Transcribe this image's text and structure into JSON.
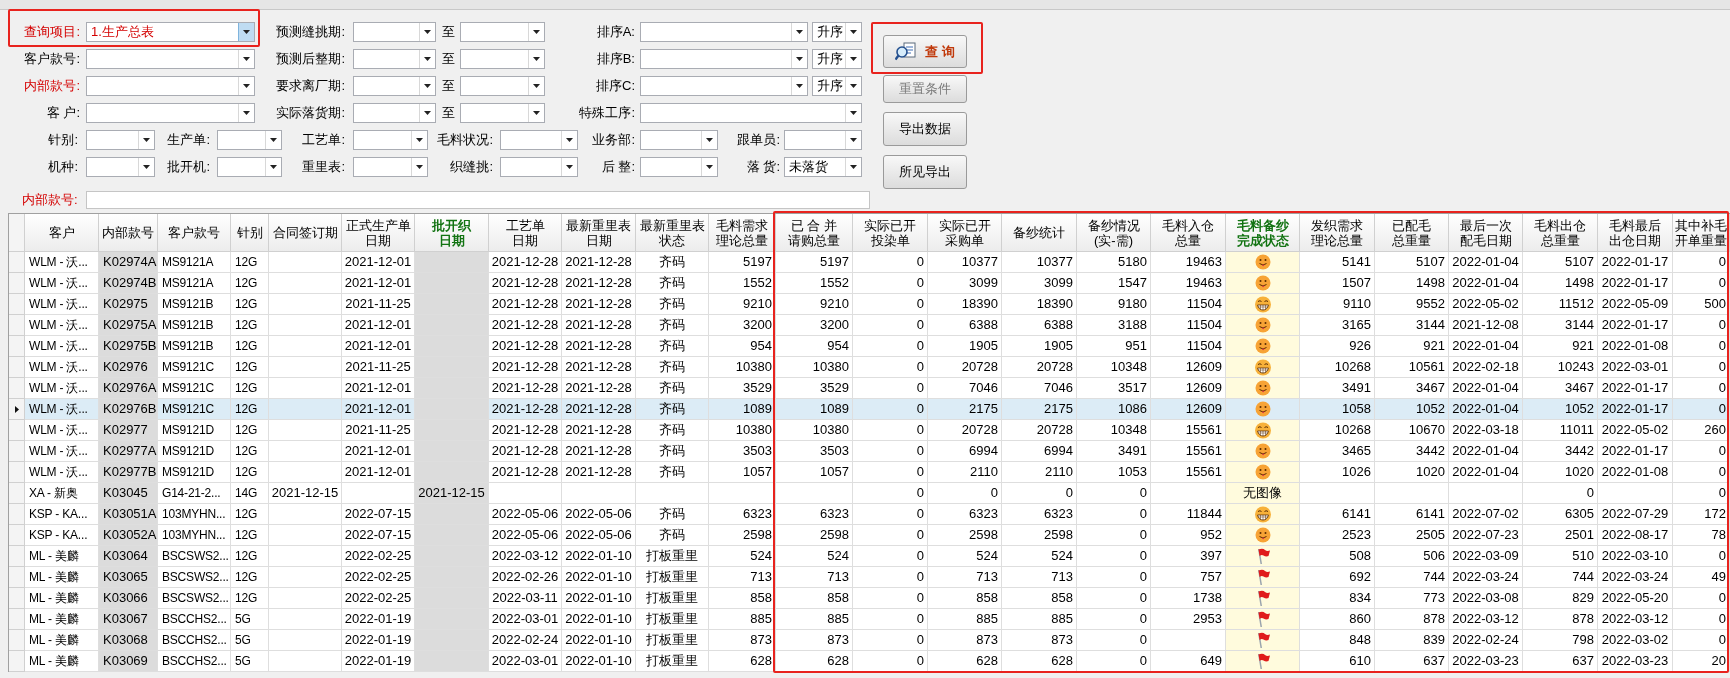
{
  "filters": {
    "rows": [
      {
        "left": {
          "label": "查询项目:",
          "value": "1.生产总表",
          "emphasis": true,
          "focused": true
        },
        "range": {
          "label": "预测缝挑期:",
          "to": "至"
        },
        "right": {
          "label": "排序A:",
          "order": "升序"
        }
      },
      {
        "left": {
          "label": "客户款号:",
          "emphasis": false
        },
        "range": {
          "label": "预测后整期:",
          "to": "至"
        },
        "right": {
          "label": "排序B:",
          "order": "升序"
        }
      },
      {
        "left": {
          "label": "内部款号:",
          "emphasis": true
        },
        "range": {
          "label": "要求离厂期:",
          "to": "至"
        },
        "right": {
          "label": "排序C:",
          "order": "升序"
        }
      },
      {
        "left": {
          "label": "客 户:",
          "emphasis": false
        },
        "range": {
          "label": "实际落货期:",
          "to": "至"
        },
        "right": {
          "label": "特殊工序:"
        }
      }
    ],
    "small_rows": [
      [
        {
          "label": "针别:"
        },
        {
          "label": "生产单:"
        },
        {
          "label": "工艺单:"
        },
        {
          "label": "毛料状况:"
        },
        {
          "label": "业务部:"
        },
        {
          "label": "跟单员:"
        }
      ],
      [
        {
          "label": "机种:"
        },
        {
          "label": "批开机:"
        },
        {
          "label": "重里表:"
        },
        {
          "label": "织缝挑:"
        },
        {
          "label": "后 整:"
        },
        {
          "label": "落 货:",
          "value": "未落货"
        }
      ]
    ],
    "bottom": {
      "label": "内部款号:",
      "emphasis": true
    }
  },
  "buttons": [
    {
      "kind": "search",
      "label": "查 询",
      "disabled": false
    },
    {
      "kind": "plain",
      "label": "重置条件",
      "disabled": true
    },
    {
      "kind": "plain",
      "label": "导出数据",
      "disabled": false
    },
    {
      "kind": "plain",
      "label": "所见导出",
      "disabled": false
    }
  ],
  "table": {
    "columns": [
      {
        "lines": [
          "客户"
        ],
        "kind": "text"
      },
      {
        "lines": [
          "内部款号"
        ],
        "kind": "shaded"
      },
      {
        "lines": [
          "客户款号"
        ],
        "kind": "text"
      },
      {
        "lines": [
          "针别"
        ],
        "kind": "text"
      },
      {
        "lines": [
          "合同签订期"
        ],
        "kind": "date"
      },
      {
        "lines": [
          "正式生产单",
          "日期"
        ],
        "kind": "date"
      },
      {
        "lines": [
          "批开织",
          "日期"
        ],
        "kind": "shaded-date",
        "highlight": true
      },
      {
        "lines": [
          "工艺单",
          "日期"
        ],
        "kind": "date"
      },
      {
        "lines": [
          "最新重里表",
          "日期"
        ],
        "kind": "date"
      },
      {
        "lines": [
          "最新重里表",
          "状态"
        ],
        "kind": "date"
      },
      {
        "lines": [
          "毛料需求",
          "理论总量"
        ],
        "kind": "number"
      },
      {
        "lines": [
          "已 合 并",
          "请购总量"
        ],
        "kind": "number"
      },
      {
        "lines": [
          "实际已开",
          "投染单"
        ],
        "kind": "number"
      },
      {
        "lines": [
          "实际已开",
          "采购单"
        ],
        "kind": "number"
      },
      {
        "lines": [
          "备纱统计"
        ],
        "kind": "number"
      },
      {
        "lines": [
          "备纱情况",
          "(实-需)"
        ],
        "kind": "number"
      },
      {
        "lines": [
          "毛料入仓",
          "总量"
        ],
        "kind": "number"
      },
      {
        "lines": [
          "毛料备纱",
          "完成状态"
        ],
        "kind": "status",
        "highlight": true
      },
      {
        "lines": [
          "发织需求",
          "理论总量"
        ],
        "kind": "number"
      },
      {
        "lines": [
          "已配毛",
          "总重量"
        ],
        "kind": "number"
      },
      {
        "lines": [
          "最后一次",
          "配毛日期"
        ],
        "kind": "date"
      },
      {
        "lines": [
          "毛料出仓",
          "总重量"
        ],
        "kind": "number"
      },
      {
        "lines": [
          "毛料最后",
          "出仓日期"
        ],
        "kind": "date"
      },
      {
        "lines": [
          "其中补毛",
          "开单重量"
        ],
        "kind": "number"
      }
    ],
    "rows": [
      {
        "selected": false,
        "status": {
          "kind": "smile"
        },
        "cells": [
          "WLM - 沃...",
          "K02974A",
          "MS9121A",
          "12G",
          "",
          "2021-12-01",
          "",
          "2021-12-28",
          "2021-12-28",
          "齐码",
          "5197",
          "5197",
          "0",
          "10377",
          "10377",
          "5180",
          "19463",
          "",
          "5141",
          "5107",
          "2022-01-04",
          "5107",
          "2022-01-17",
          "0"
        ]
      },
      {
        "selected": false,
        "status": {
          "kind": "smile"
        },
        "cells": [
          "WLM - 沃...",
          "K02974B",
          "MS9121A",
          "12G",
          "",
          "2021-12-01",
          "",
          "2021-12-28",
          "2021-12-28",
          "齐码",
          "1552",
          "1552",
          "0",
          "3099",
          "3099",
          "1547",
          "19463",
          "",
          "1507",
          "1498",
          "2022-01-04",
          "1498",
          "2022-01-17",
          "0"
        ]
      },
      {
        "selected": false,
        "status": {
          "kind": "grin"
        },
        "cells": [
          "WLM - 沃...",
          "K02975",
          "MS9121B",
          "12G",
          "",
          "2021-11-25",
          "",
          "2021-12-28",
          "2021-12-28",
          "齐码",
          "9210",
          "9210",
          "0",
          "18390",
          "18390",
          "9180",
          "11504",
          "",
          "9110",
          "9552",
          "2022-05-02",
          "11512",
          "2022-05-09",
          "500"
        ]
      },
      {
        "selected": false,
        "status": {
          "kind": "smile"
        },
        "cells": [
          "WLM - 沃...",
          "K02975A",
          "MS9121B",
          "12G",
          "",
          "2021-12-01",
          "",
          "2021-12-28",
          "2021-12-28",
          "齐码",
          "3200",
          "3200",
          "0",
          "6388",
          "6388",
          "3188",
          "11504",
          "",
          "3165",
          "3144",
          "2021-12-08",
          "3144",
          "2022-01-17",
          "0"
        ]
      },
      {
        "selected": false,
        "status": {
          "kind": "smile"
        },
        "cells": [
          "WLM - 沃...",
          "K02975B",
          "MS9121B",
          "12G",
          "",
          "2021-12-01",
          "",
          "2021-12-28",
          "2021-12-28",
          "齐码",
          "954",
          "954",
          "0",
          "1905",
          "1905",
          "951",
          "11504",
          "",
          "926",
          "921",
          "2022-01-04",
          "921",
          "2022-01-08",
          "0"
        ]
      },
      {
        "selected": false,
        "status": {
          "kind": "grin"
        },
        "cells": [
          "WLM - 沃...",
          "K02976",
          "MS9121C",
          "12G",
          "",
          "2021-11-25",
          "",
          "2021-12-28",
          "2021-12-28",
          "齐码",
          "10380",
          "10380",
          "0",
          "20728",
          "20728",
          "10348",
          "12609",
          "",
          "10268",
          "10561",
          "2022-02-18",
          "10243",
          "2022-03-01",
          "0"
        ]
      },
      {
        "selected": false,
        "status": {
          "kind": "smile"
        },
        "cells": [
          "WLM - 沃...",
          "K02976A",
          "MS9121C",
          "12G",
          "",
          "2021-12-01",
          "",
          "2021-12-28",
          "2021-12-28",
          "齐码",
          "3529",
          "3529",
          "0",
          "7046",
          "7046",
          "3517",
          "12609",
          "",
          "3491",
          "3467",
          "2022-01-04",
          "3467",
          "2022-01-17",
          "0"
        ]
      },
      {
        "selected": true,
        "status": {
          "kind": "smile"
        },
        "cells": [
          "WLM - 沃...",
          "K02976B",
          "MS9121C",
          "12G",
          "",
          "2021-12-01",
          "",
          "2021-12-28",
          "2021-12-28",
          "齐码",
          "1089",
          "1089",
          "0",
          "2175",
          "2175",
          "1086",
          "12609",
          "",
          "1058",
          "1052",
          "2022-01-04",
          "1052",
          "2022-01-17",
          "0"
        ]
      },
      {
        "selected": false,
        "status": {
          "kind": "grin"
        },
        "cells": [
          "WLM - 沃...",
          "K02977",
          "MS9121D",
          "12G",
          "",
          "2021-11-25",
          "",
          "2021-12-28",
          "2021-12-28",
          "齐码",
          "10380",
          "10380",
          "0",
          "20728",
          "20728",
          "10348",
          "15561",
          "",
          "10268",
          "10670",
          "2022-03-18",
          "11011",
          "2022-05-02",
          "260"
        ]
      },
      {
        "selected": false,
        "status": {
          "kind": "smile"
        },
        "cells": [
          "WLM - 沃...",
          "K02977A",
          "MS9121D",
          "12G",
          "",
          "2021-12-01",
          "",
          "2021-12-28",
          "2021-12-28",
          "齐码",
          "3503",
          "3503",
          "0",
          "6994",
          "6994",
          "3491",
          "15561",
          "",
          "3465",
          "3442",
          "2022-01-04",
          "3442",
          "2022-01-17",
          "0"
        ]
      },
      {
        "selected": false,
        "status": {
          "kind": "smile"
        },
        "cells": [
          "WLM - 沃...",
          "K02977B",
          "MS9121D",
          "12G",
          "",
          "2021-12-01",
          "",
          "2021-12-28",
          "2021-12-28",
          "齐码",
          "1057",
          "1057",
          "0",
          "2110",
          "2110",
          "1053",
          "15561",
          "",
          "1026",
          "1020",
          "2022-01-04",
          "1020",
          "2022-01-08",
          "0"
        ]
      },
      {
        "selected": false,
        "status": {
          "kind": "text",
          "text": "无图像"
        },
        "cells": [
          "XA - 新奥",
          "K03045",
          "G14-21-2...",
          "14G",
          "2021-12-15",
          "",
          "2021-12-15",
          "",
          "",
          "",
          "",
          "",
          "0",
          "0",
          "0",
          "0",
          "",
          "",
          "",
          "",
          "",
          "0",
          "",
          "0"
        ]
      },
      {
        "selected": false,
        "status": {
          "kind": "grin"
        },
        "cells": [
          "KSP - KA...",
          "K03051A",
          "103MYHN...",
          "12G",
          "",
          "2022-07-15",
          "",
          "2022-05-06",
          "2022-05-06",
          "齐码",
          "6323",
          "6323",
          "0",
          "6323",
          "6323",
          "0",
          "11844",
          "",
          "6141",
          "6141",
          "2022-07-02",
          "6305",
          "2022-07-29",
          "172"
        ]
      },
      {
        "selected": false,
        "status": {
          "kind": "smile"
        },
        "cells": [
          "KSP - KA...",
          "K03052A",
          "103MYHN...",
          "12G",
          "",
          "2022-07-15",
          "",
          "2022-05-06",
          "2022-05-06",
          "齐码",
          "2598",
          "2598",
          "0",
          "2598",
          "2598",
          "0",
          "952",
          "",
          "2523",
          "2505",
          "2022-07-23",
          "2501",
          "2022-08-17",
          "78"
        ]
      },
      {
        "selected": false,
        "status": {
          "kind": "flag"
        },
        "cells": [
          "ML - 美麟",
          "K03064",
          "BSCSWS2...",
          "12G",
          "",
          "2022-02-25",
          "",
          "2022-03-12",
          "2022-01-10",
          "打板重里",
          "524",
          "524",
          "0",
          "524",
          "524",
          "0",
          "397",
          "",
          "508",
          "506",
          "2022-03-09",
          "510",
          "2022-03-10",
          "0"
        ]
      },
      {
        "selected": false,
        "status": {
          "kind": "flag"
        },
        "cells": [
          "ML - 美麟",
          "K03065",
          "BSCSWS2...",
          "12G",
          "",
          "2022-02-25",
          "",
          "2022-02-26",
          "2022-01-10",
          "打板重里",
          "713",
          "713",
          "0",
          "713",
          "713",
          "0",
          "757",
          "",
          "692",
          "744",
          "2022-03-24",
          "744",
          "2022-03-24",
          "49"
        ]
      },
      {
        "selected": false,
        "status": {
          "kind": "flag"
        },
        "cells": [
          "ML - 美麟",
          "K03066",
          "BSCSWS2...",
          "12G",
          "",
          "2022-02-25",
          "",
          "2022-03-11",
          "2022-01-10",
          "打板重里",
          "858",
          "858",
          "0",
          "858",
          "858",
          "0",
          "1738",
          "",
          "834",
          "773",
          "2022-03-08",
          "829",
          "2022-05-20",
          "0"
        ]
      },
      {
        "selected": false,
        "status": {
          "kind": "flag"
        },
        "cells": [
          "ML - 美麟",
          "K03067",
          "BSCCHS2...",
          "5G",
          "",
          "2022-01-19",
          "",
          "2022-03-01",
          "2022-01-10",
          "打板重里",
          "885",
          "885",
          "0",
          "885",
          "885",
          "0",
          "2953",
          "",
          "860",
          "878",
          "2022-03-12",
          "878",
          "2022-03-12",
          "0"
        ]
      },
      {
        "selected": false,
        "status": {
          "kind": "flag"
        },
        "cells": [
          "ML - 美麟",
          "K03068",
          "BSCCHS2...",
          "5G",
          "",
          "2022-01-19",
          "",
          "2022-02-24",
          "2022-01-10",
          "打板重里",
          "873",
          "873",
          "0",
          "873",
          "873",
          "0",
          "",
          "",
          "848",
          "839",
          "2022-02-24",
          "798",
          "2022-03-02",
          "0"
        ]
      },
      {
        "selected": false,
        "status": {
          "kind": "flag"
        },
        "cells": [
          "ML - 美麟",
          "K03069",
          "BSCCHS2...",
          "5G",
          "",
          "2022-01-19",
          "",
          "2022-03-01",
          "2022-01-10",
          "打板重里",
          "628",
          "628",
          "0",
          "628",
          "628",
          "0",
          "649",
          "",
          "610",
          "637",
          "2022-03-23",
          "637",
          "2022-03-23",
          "20"
        ]
      }
    ]
  }
}
